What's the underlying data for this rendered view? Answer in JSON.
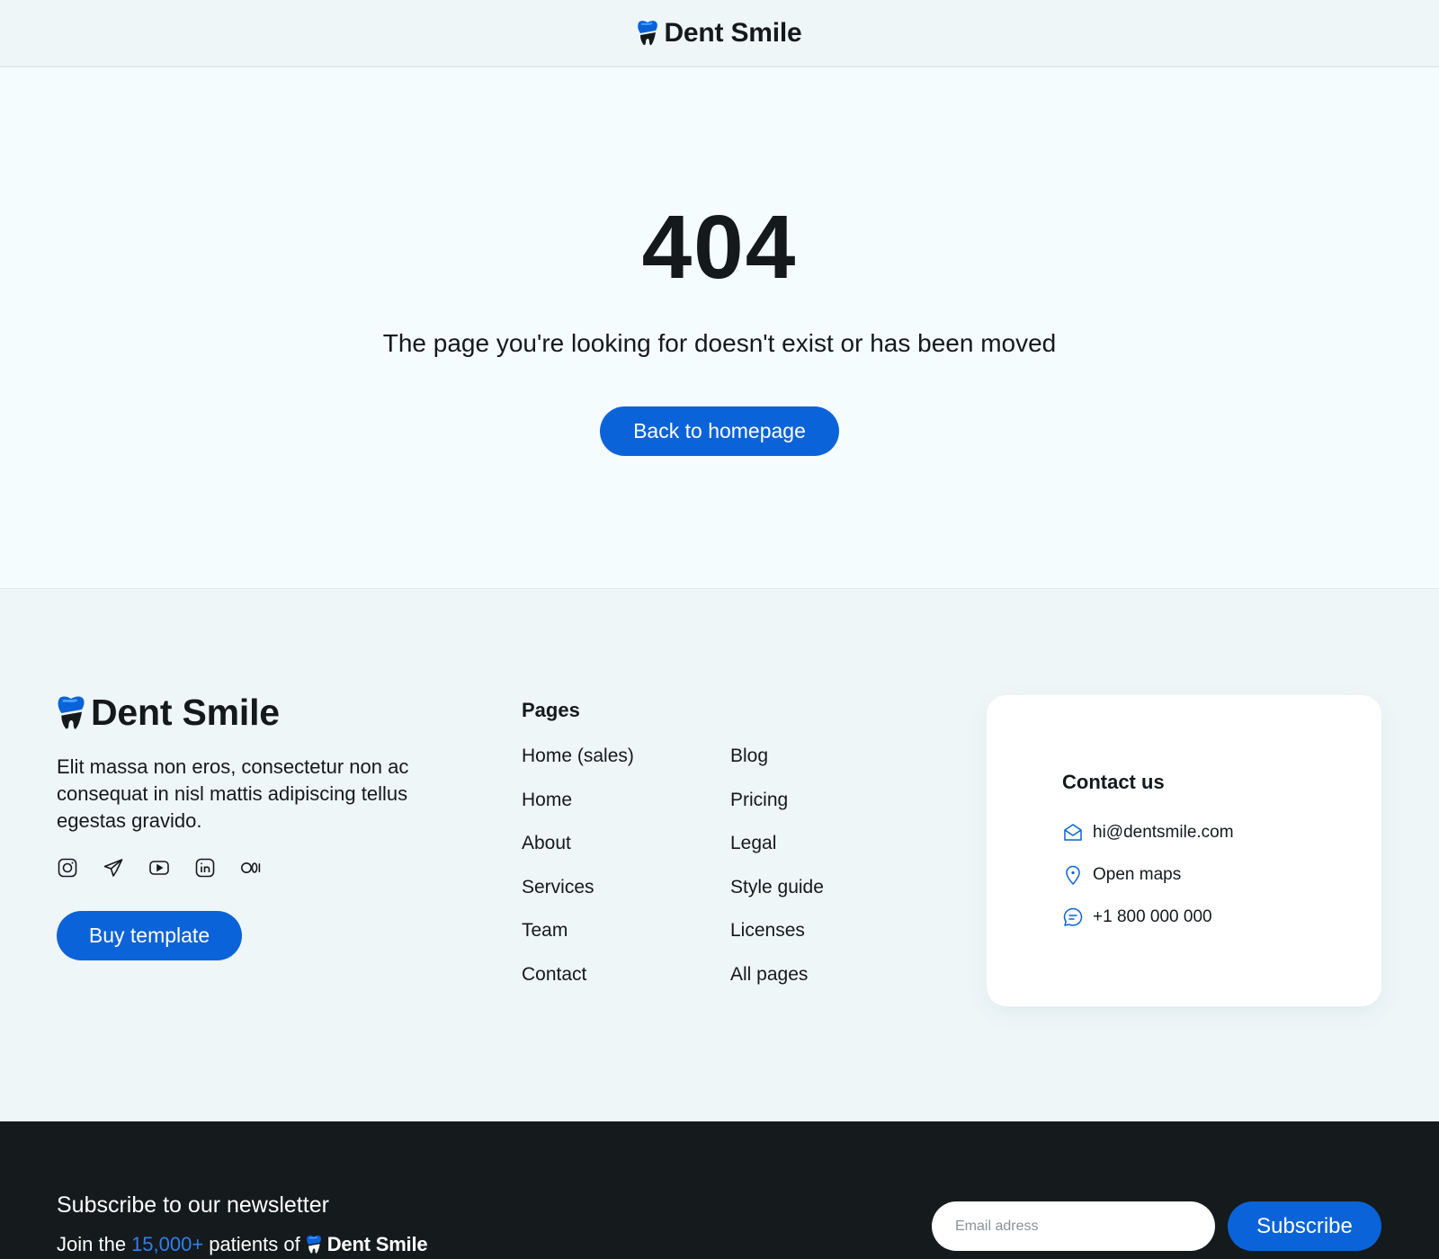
{
  "brand": {
    "name": "Dent Smile",
    "colors": {
      "primary": "#0a63d8",
      "dark": "#15191c",
      "accent_link": "#2f7ff0",
      "logo_light": "#4aa3ff"
    }
  },
  "header": {
    "logo_icon": "tooth-icon"
  },
  "error": {
    "code": "404",
    "message": "The page you're looking for doesn't exist or has been moved",
    "button_label": "Back to homepage"
  },
  "footer": {
    "description": "Elit massa non eros, consectetur non ac consequat in nisl mattis adipiscing tellus egestas gravido.",
    "socials": [
      "instagram-icon",
      "telegram-icon",
      "youtube-icon",
      "linkedin-icon",
      "medium-icon"
    ],
    "buy_label": "Buy template",
    "pages_title": "Pages",
    "pages_col1": [
      "Home (sales)",
      "Home",
      "About",
      "Services",
      "Team",
      "Contact"
    ],
    "pages_col2": [
      "Blog",
      "Pricing",
      "Legal",
      "Style guide",
      "Licenses",
      "All pages"
    ],
    "contact": {
      "title": "Contact us",
      "email": "hi@dentsmile.com",
      "maps": "Open maps",
      "phone": "+1 800 000 000"
    }
  },
  "newsletter": {
    "title": "Subscribe to our newsletter",
    "sub_prefix": "Join the",
    "sub_count": "15,000+",
    "sub_suffix": "patients of",
    "email_placeholder": "Email adress",
    "subscribe_label": "Subscribe"
  }
}
